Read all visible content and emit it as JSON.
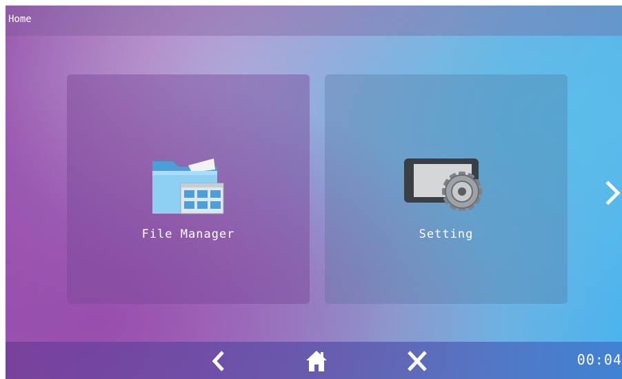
{
  "window": {
    "title": "Home"
  },
  "apps": [
    {
      "label": "File Manager",
      "icon": "folder-icon"
    },
    {
      "label": "Setting",
      "icon": "settings-tablet-gear-icon"
    }
  ],
  "pager": {
    "next_icon": "chevron-right-icon"
  },
  "navbar": {
    "back_icon": "chevron-left-icon",
    "home_icon": "home-icon",
    "close_icon": "close-icon",
    "time": "00:04"
  },
  "colors": {
    "tile_file": "#7a4696",
    "tile_setting": "#506e96",
    "text": "#ffffff"
  }
}
